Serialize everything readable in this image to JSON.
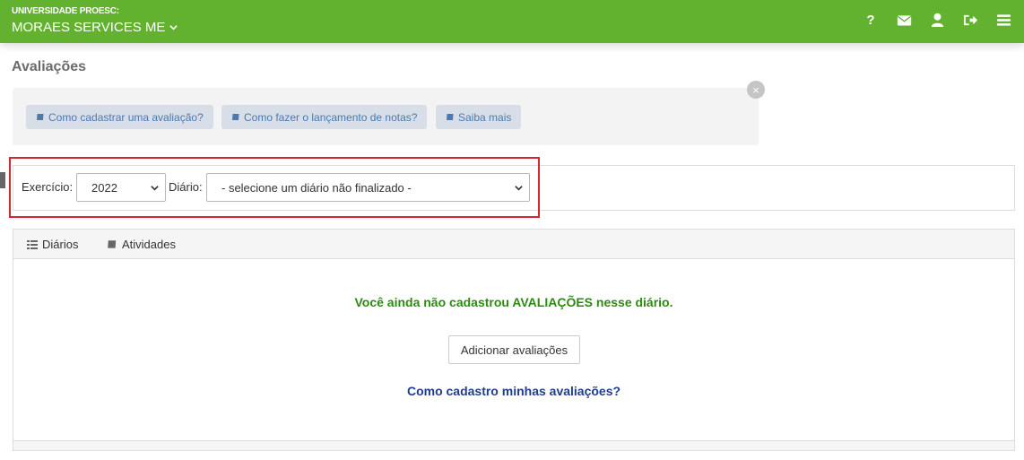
{
  "topbar": {
    "org_label": "UNIVERSIDADE PROESC:",
    "company": "MORAES SERVICES ME",
    "icons": [
      "question-icon",
      "envelope-icon",
      "user-icon",
      "sign-out-icon",
      "hamburger-menu-icon"
    ],
    "question_glyph": "?"
  },
  "page": {
    "title": "Avaliações"
  },
  "help": {
    "buttons": [
      {
        "label": "Como cadastrar uma avaliação?",
        "icon": "book-icon"
      },
      {
        "label": "Como fazer o lançamento de notas?",
        "icon": "book-icon"
      },
      {
        "label": "Saiba mais",
        "icon": "book-icon"
      }
    ],
    "close_glyph": "×"
  },
  "filters": {
    "exercicio_label": "Exercício:",
    "exercicio_value": "2022",
    "diario_label": "Diário:",
    "diario_value": "- selecione um diário não finalizado -"
  },
  "tabs": [
    {
      "label": "Diários",
      "icon": "list-icon"
    },
    {
      "label": "Atividades",
      "icon": "book-icon"
    }
  ],
  "content": {
    "empty_message": "Você ainda não cadastrou AVALIAÇÕES nesse diário.",
    "add_button": "Adicionar avaliações",
    "howto_link": "Como cadastro minhas avaliações?"
  },
  "colors": {
    "topbar": "#63b22f",
    "help_button_bg": "#d7dee8",
    "help_button_text": "#4d79ad",
    "success_text": "#2d8a12",
    "link_text": "#1f3d8f",
    "highlight_border": "#d6262e"
  }
}
